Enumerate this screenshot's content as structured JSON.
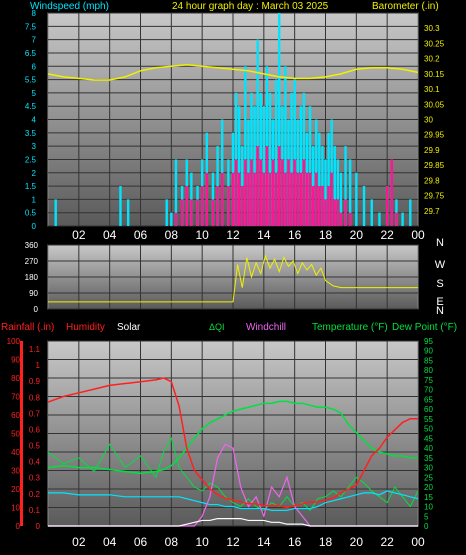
{
  "header": {
    "left_label": "Windspeed (mph)",
    "title": "24 hour graph day : March 03 2025",
    "right_label": "Barometer (.in)"
  },
  "colors": {
    "background": "#000000",
    "plot_top": "#c8c8c8",
    "plot_bottom": "#555555",
    "grid": "#333333",
    "cyan": "#00e5ff",
    "magenta": "#ff1493",
    "yellow": "#f0f000",
    "green": "#00e040",
    "red": "#ff2020",
    "violet": "#ee66ee",
    "white": "#ffffff"
  },
  "x_ticks": [
    "02",
    "04",
    "06",
    "08",
    "10",
    "12",
    "14",
    "16",
    "18",
    "20",
    "22",
    "00"
  ],
  "chart_data": [
    {
      "type": "bar",
      "name": "wind",
      "ylim": [
        0,
        8
      ],
      "y_ticks": [
        "0",
        "0.5",
        "1",
        "1.5",
        "2",
        "2.5",
        "3",
        "3.5",
        "4",
        "4.5",
        "5",
        "5.5",
        "6",
        "6.5",
        "7",
        "7.5",
        "8"
      ],
      "y2lim": [
        29.65,
        30.35
      ],
      "y2_ticks": [
        "29.7",
        "29.75",
        "29.8",
        "29.85",
        "29.9",
        "29.95",
        "30",
        "30.05",
        "30.1",
        "30.15",
        "30.2",
        "30.25",
        "30.3"
      ],
      "x": [
        0.5,
        1,
        2,
        3,
        4,
        4.7,
        5.2,
        6,
        7,
        7.7,
        8,
        8.3,
        8.7,
        9,
        9.3,
        9.7,
        10,
        10.3,
        10.7,
        11,
        11.3,
        11.7,
        12,
        12.2,
        12.4,
        12.6,
        12.8,
        13,
        13.2,
        13.4,
        13.6,
        13.8,
        14,
        14.2,
        14.4,
        14.6,
        14.8,
        15,
        15.2,
        15.4,
        15.6,
        15.8,
        16,
        16.2,
        16.4,
        16.6,
        16.8,
        17,
        17.2,
        17.4,
        17.6,
        17.8,
        18,
        18.2,
        18.4,
        18.6,
        18.8,
        19,
        19.3,
        19.6,
        20,
        20.5,
        21,
        21.5,
        22,
        22.3,
        22.6,
        23,
        23.5
      ],
      "gust": [
        1,
        0,
        0,
        0,
        0,
        1.5,
        1,
        0,
        0,
        1,
        0.5,
        2.5,
        1.5,
        2.5,
        2,
        1.5,
        2.5,
        3.5,
        2,
        3,
        4,
        2.5,
        3.5,
        5,
        4.5,
        3,
        6,
        4,
        5,
        4.5,
        7,
        5,
        4.5,
        6,
        5,
        4,
        5.5,
        8,
        4.5,
        6,
        4,
        5,
        5.5,
        4,
        4.5,
        5,
        3.5,
        4.5,
        3,
        4,
        3.5,
        3,
        2.5,
        3.5,
        4,
        3,
        2.5,
        2,
        3,
        2.5,
        2,
        1.5,
        1,
        0.5,
        1.5,
        2,
        1,
        0.5,
        1
      ],
      "speed": [
        0,
        0,
        0,
        0,
        0,
        0,
        0,
        0,
        0,
        0,
        0,
        0.5,
        1,
        1.5,
        1,
        1,
        1.5,
        2,
        1,
        1.5,
        2,
        1.5,
        2,
        2.5,
        2,
        1.5,
        2.5,
        2,
        2.5,
        2,
        3,
        2.5,
        2,
        3,
        2,
        2.5,
        2,
        3,
        2.5,
        2,
        2.5,
        2,
        2.5,
        2,
        2,
        2.5,
        2,
        2,
        1.5,
        2,
        1.5,
        1.5,
        1,
        1.5,
        2,
        1,
        1,
        0.5,
        1,
        0.5,
        0,
        0,
        0,
        0,
        1.5,
        2.5,
        0.5,
        0,
        0
      ],
      "barometer_x": [
        0,
        1,
        2,
        3,
        4,
        5,
        6,
        7,
        8,
        9,
        10,
        11,
        12,
        13,
        14,
        15,
        16,
        17,
        18,
        19,
        20,
        21,
        22,
        23,
        24
      ],
      "barometer": [
        30.15,
        30.14,
        30.135,
        30.13,
        30.13,
        30.14,
        30.16,
        30.17,
        30.175,
        30.18,
        30.175,
        30.17,
        30.165,
        30.16,
        30.15,
        30.14,
        30.135,
        30.135,
        30.14,
        30.15,
        30.165,
        30.17,
        30.17,
        30.165,
        30.155
      ]
    },
    {
      "type": "line",
      "name": "wind_direction",
      "ylim": [
        0,
        360
      ],
      "y_ticks": [
        "0",
        "90",
        "180",
        "270",
        "360"
      ],
      "compass": [
        "N",
        "W",
        "S",
        "E",
        "N"
      ],
      "x": [
        0,
        7.5,
        8,
        8.5,
        9,
        9.5,
        10,
        10.5,
        11,
        11.5,
        12,
        12.3,
        12.6,
        12.9,
        13.2,
        13.5,
        13.8,
        14.1,
        14.4,
        14.7,
        15,
        15.3,
        15.6,
        15.9,
        16.2,
        16.5,
        16.8,
        17.1,
        17.4,
        17.7,
        18,
        18.5,
        19,
        20,
        21,
        22,
        23,
        24
      ],
      "values": [
        40,
        40,
        40,
        40,
        40,
        40,
        40,
        40,
        40,
        40,
        40,
        250,
        120,
        290,
        180,
        260,
        200,
        300,
        230,
        280,
        210,
        290,
        240,
        270,
        200,
        260,
        220,
        250,
        190,
        230,
        160,
        130,
        120,
        120,
        120,
        120,
        120,
        120
      ]
    },
    {
      "type": "line",
      "name": "weather",
      "legend": [
        "Rainfall (.in)",
        "Humidity",
        "Solar",
        "ΔQI",
        "Windchill",
        "Temperature (°F)",
        "Dew Point (°F)"
      ],
      "ylim_left": [
        0,
        100
      ],
      "y_ticks_left": [
        "0",
        "10",
        "20",
        "30",
        "40",
        "50",
        "60",
        "70",
        "80",
        "90",
        "100"
      ],
      "rain_ticks": [
        "0",
        "0.1",
        "0.2",
        "0.3",
        "0.4",
        "0.5",
        "0.6",
        "0.7",
        "0.8",
        "0.9",
        "1",
        "1.1"
      ],
      "ylim_right": [
        0,
        95
      ],
      "y_ticks_right": [
        "0",
        "5",
        "10",
        "15",
        "20",
        "25",
        "30",
        "35",
        "40",
        "45",
        "50",
        "55",
        "60",
        "65",
        "70",
        "75",
        "80",
        "85",
        "90",
        "95"
      ],
      "x": [
        0,
        1,
        2,
        3,
        4,
        5,
        6,
        7,
        7.5,
        8,
        8.5,
        9,
        9.5,
        10,
        10.5,
        11,
        11.5,
        12,
        12.5,
        13,
        13.5,
        14,
        14.5,
        15,
        15.5,
        16,
        16.5,
        17,
        17.5,
        18,
        18.5,
        19,
        19.5,
        20,
        20.5,
        21,
        21.5,
        22,
        22.5,
        23,
        23.5,
        24
      ],
      "humidity": [
        67,
        70,
        72,
        74,
        76,
        77,
        78,
        79,
        80,
        78,
        65,
        42,
        30,
        25,
        20,
        17,
        15,
        14,
        13,
        12,
        12,
        11,
        11,
        11,
        10,
        11,
        12,
        13,
        13,
        14,
        15,
        18,
        20,
        22,
        30,
        38,
        42,
        48,
        52,
        56,
        58,
        58
      ],
      "temperature": [
        30,
        31,
        30,
        30,
        29,
        28,
        27,
        28,
        29,
        31,
        35,
        40,
        45,
        50,
        53,
        55,
        57,
        59,
        60,
        61,
        62,
        63,
        63,
        64,
        64,
        63,
        63,
        62,
        61,
        61,
        60,
        58,
        52,
        48,
        44,
        40,
        38,
        37,
        36,
        36,
        35,
        35
      ],
      "dew_point": [
        17,
        17,
        16,
        16,
        16,
        15,
        15,
        15,
        15,
        15,
        15,
        14,
        13,
        12,
        11,
        11,
        10,
        10,
        9,
        9,
        9,
        9,
        8,
        8,
        8,
        9,
        9,
        9,
        10,
        12,
        13,
        14,
        15,
        16,
        17,
        17,
        16,
        18,
        17,
        16,
        15,
        14
      ],
      "aqi": [
        38,
        32,
        35,
        28,
        42,
        30,
        36,
        25,
        38,
        45,
        30,
        25,
        20,
        18,
        22,
        20,
        15,
        12,
        10,
        14,
        10,
        8,
        12,
        10,
        15,
        10,
        12,
        8,
        14,
        15,
        18,
        15,
        20,
        25,
        22,
        18,
        15,
        12,
        20,
        15,
        10,
        18
      ],
      "windchill": [
        0,
        0,
        0,
        0,
        0,
        0,
        0,
        0,
        0,
        0,
        0,
        0,
        0,
        5,
        15,
        35,
        42,
        40,
        20,
        10,
        15,
        5,
        20,
        15,
        25,
        10,
        5,
        0,
        0,
        0,
        0,
        0,
        0,
        0,
        0,
        0,
        0,
        0,
        0,
        0,
        0,
        0
      ],
      "solar": [
        0,
        0,
        0,
        0,
        0,
        0,
        0,
        0,
        0,
        0,
        0,
        1,
        2,
        3,
        3,
        4,
        4,
        4,
        4,
        3,
        3,
        3,
        2,
        2,
        1,
        1,
        1,
        0,
        0,
        0,
        0,
        0,
        0,
        0,
        0,
        0,
        0,
        0,
        0,
        0,
        0,
        0
      ]
    }
  ]
}
